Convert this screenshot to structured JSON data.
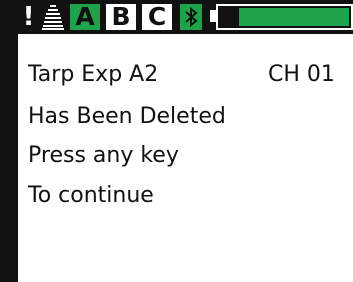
{
  "status_bar": {
    "alert_icon": "exclamation-icon",
    "alert_glyph": "!",
    "menu_icon": "stacked-lines-icon",
    "channels": [
      "A",
      "B",
      "C"
    ],
    "active_channel": "A",
    "bluetooth_icon": "bluetooth-icon",
    "battery_icon": "battery-icon",
    "battery_level": 0.85
  },
  "message": {
    "title": "Tarp Exp A2",
    "channel": "CH 01",
    "line2": "Has Been Deleted",
    "line3": "Press any key",
    "line4": "To continue"
  },
  "colors": {
    "accent_green": "#1fa34a",
    "frame_black": "#111111",
    "background": "#ffffff"
  }
}
